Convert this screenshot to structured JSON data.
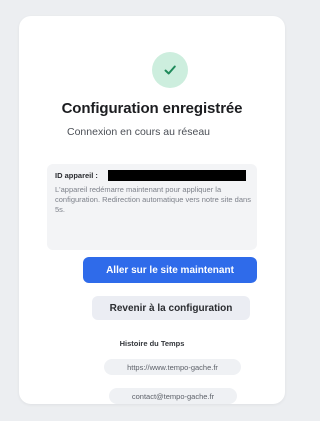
{
  "icons": {
    "success": "check-icon"
  },
  "colors": {
    "primary": "#2f6bea",
    "success_bg": "#cdeede",
    "success_fg": "#1f8a5b"
  },
  "header": {
    "title": "Configuration enregistrée",
    "subtitle": "Connexion en cours au réseau"
  },
  "info": {
    "id_label": "ID appareil :",
    "message": "L'appareil redémarre maintenant pour appliquer la configuration. Redirection automatique vers notre site dans 5s."
  },
  "actions": {
    "primary_label": "Aller sur le site maintenant",
    "secondary_label": "Revenir à la configuration"
  },
  "footer": {
    "title": "Histoire du Temps",
    "website": "https://www.tempo-gache.fr",
    "email": "contact@tempo-gache.fr"
  }
}
